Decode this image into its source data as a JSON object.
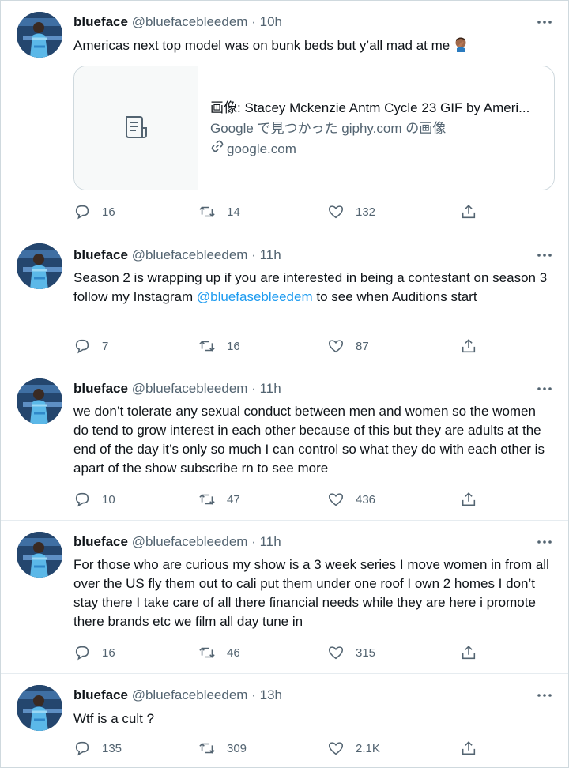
{
  "tweets": [
    {
      "name": "blueface",
      "handle": "@bluefacebleedem",
      "dot": "·",
      "time": "10h",
      "text": "Americas next top model was on bunk beds but y’all mad at me",
      "emoji_icon": "facepalm-emoji",
      "card": {
        "title": "画像: Stacey Mckenzie Antm Cycle 23 GIF by Ameri...",
        "desc": "Google で見つかった giphy.com の画像",
        "domain": "google.com",
        "media_icon": "document-icon",
        "domain_icon": "link-icon"
      },
      "replies": "16",
      "retweets": "14",
      "likes": "132"
    },
    {
      "name": "blueface",
      "handle": "@bluefacebleedem",
      "dot": "·",
      "time": "11h",
      "text_before": "Season 2 is wrapping up if you are interested in being a contestant on season 3 follow my Instagram ",
      "mention": "@bluefasebleedem",
      "text_after": " to see when Auditions start",
      "replies": "7",
      "retweets": "16",
      "likes": "87"
    },
    {
      "name": "blueface",
      "handle": "@bluefacebleedem",
      "dot": "·",
      "time": "11h",
      "text": "we don’t tolerate any sexual conduct between men and women so the women do tend to grow interest in each other because of this but they are adults at the end of the day it’s only so much I can control so what they do with each other is apart of the show subscribe rn to see more",
      "replies": "10",
      "retweets": "47",
      "likes": "436"
    },
    {
      "name": "blueface",
      "handle": "@bluefacebleedem",
      "dot": "·",
      "time": "11h",
      "text": "For those who are curious my show is a 3 week series I move women in from all over the US fly them out to cali put them under one roof I own 2 homes I don’t stay there I take care of all there financial needs while they are here i promote there brands etc we film all day tune in",
      "replies": "16",
      "retweets": "46",
      "likes": "315"
    },
    {
      "name": "blueface",
      "handle": "@bluefacebleedem",
      "dot": "·",
      "time": "13h",
      "text": "Wtf is a cult ?",
      "replies": "135",
      "retweets": "309",
      "likes": "2.1K"
    }
  ],
  "colors": {
    "accent": "#1d9bf0",
    "muted": "#536471",
    "text": "#0f1419",
    "border": "#cfd9de"
  }
}
